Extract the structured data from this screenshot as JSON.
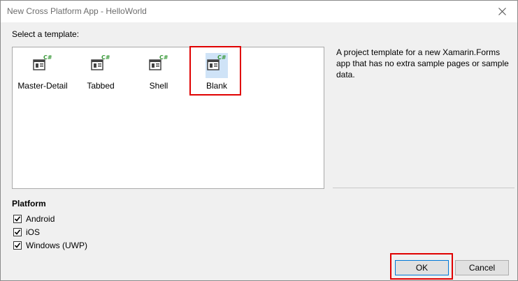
{
  "window": {
    "title": "New Cross Platform App - HelloWorld"
  },
  "template_section": {
    "label": "Select a template:",
    "templates": [
      {
        "label": "Master-Detail",
        "icon": "csharp-template-icon"
      },
      {
        "label": "Tabbed",
        "icon": "csharp-template-icon"
      },
      {
        "label": "Shell",
        "icon": "csharp-template-icon"
      },
      {
        "label": "Blank",
        "icon": "csharp-template-icon",
        "selected": true
      }
    ],
    "description": "A project template for a new Xamarin.Forms app that has no extra sample pages or sample data."
  },
  "platform": {
    "heading": "Platform",
    "options": [
      {
        "label": "Android",
        "checked": true
      },
      {
        "label": "iOS",
        "checked": true
      },
      {
        "label": "Windows (UWP)",
        "checked": true
      }
    ]
  },
  "buttons": {
    "ok": "OK",
    "cancel": "Cancel"
  },
  "colors": {
    "highlight_box": "#e00000",
    "selection": "#cfe3f7",
    "csharp_badge": "#3a9a3a"
  }
}
